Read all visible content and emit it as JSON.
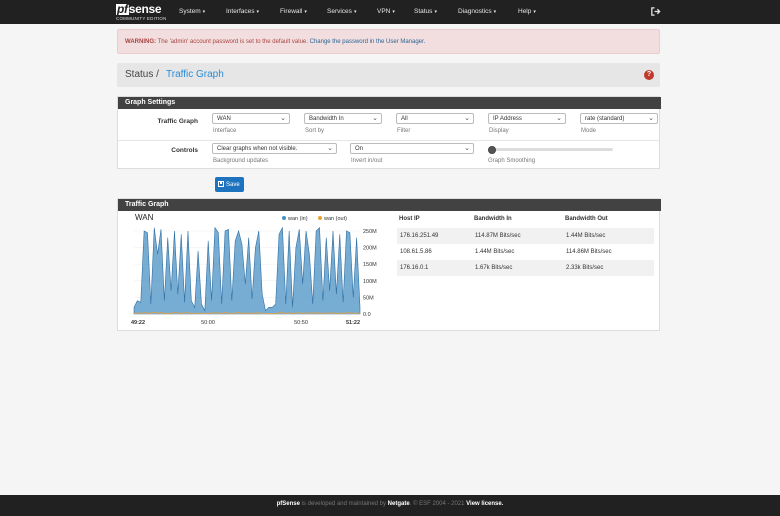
{
  "brand": {
    "logo_pf": "pf",
    "logo_rest": "sense",
    "edition": "COMMUNITY EDITION"
  },
  "nav": [
    "System",
    "Interfaces",
    "Firewall",
    "Services",
    "VPN",
    "Status",
    "Diagnostics",
    "Help"
  ],
  "nav_caret": "▾",
  "icons": {
    "logout": "logout-icon",
    "help": "help-icon",
    "save": "floppy-disk-icon"
  },
  "alert": {
    "label": "WARNING:",
    "message": " The 'admin' account password is set to the default value. ",
    "link": "Change the password in the User Manager."
  },
  "breadcrumb": {
    "root": "Status /",
    "current": "Traffic Graph",
    "help_glyph": "?"
  },
  "settings": {
    "heading": "Graph Settings",
    "row1_label": "Traffic Graph",
    "row2_label": "Controls",
    "interface": {
      "value": "WAN",
      "help": "Interface"
    },
    "sort_by": {
      "value": "Bandwidth In",
      "help": "Sort by"
    },
    "filter": {
      "value": "All",
      "help": "Filter"
    },
    "display": {
      "value": "IP Address",
      "help": "Display"
    },
    "mode": {
      "value": "rate (standard)",
      "help": "Mode"
    },
    "background_updates": {
      "value": "Clear graphs when not visible.",
      "help": "Background updates"
    },
    "invert": {
      "value": "On",
      "help": "Invert in/out"
    },
    "smoothing": {
      "help": "Graph Smoothing",
      "level": 0
    }
  },
  "save_label": "Save",
  "graph": {
    "heading": "Traffic Graph",
    "title": "WAN",
    "legend_in": "wan (in)",
    "legend_out": "wan (out)",
    "color_in": "#4a90c4",
    "color_out": "#f0a030"
  },
  "chart_data": {
    "type": "area",
    "title": "WAN",
    "x_ticks": [
      "49:22",
      "50:00",
      "50:50",
      "51:22"
    ],
    "y_ticks": [
      "250M",
      "200M",
      "150M",
      "100M",
      "50M",
      "0.0"
    ],
    "ylim": [
      0,
      280
    ],
    "y_unit": "M bits/sec",
    "legend_position": "top-right",
    "series": [
      {
        "name": "wan (in)",
        "color": "#4a90c4",
        "values": [
          20,
          40,
          35,
          250,
          245,
          30,
          260,
          180,
          255,
          40,
          230,
          70,
          250,
          60,
          240,
          35,
          250,
          40,
          20,
          190,
          30,
          10,
          220,
          40,
          260,
          245,
          30,
          250,
          255,
          40,
          220,
          250,
          210,
          90,
          230,
          45,
          200,
          250,
          60,
          10,
          20,
          20,
          30,
          240,
          260,
          30,
          250,
          20,
          200,
          255,
          90,
          250,
          180,
          30,
          250,
          260,
          40,
          230,
          70,
          250,
          60,
          240,
          35,
          250,
          245,
          50,
          230,
          20
        ]
      },
      {
        "name": "wan (out)",
        "color": "#f0a030",
        "values": [
          2,
          3,
          2,
          4,
          3,
          2,
          5,
          3,
          4,
          2,
          3,
          2,
          4,
          3,
          2,
          3,
          4,
          2,
          2,
          3,
          2,
          1,
          3,
          2,
          4,
          3,
          2,
          4,
          3,
          2,
          3,
          4,
          3,
          2,
          3,
          2,
          3,
          4,
          2,
          1,
          2,
          2,
          2,
          3,
          4,
          2,
          3,
          2,
          3,
          4,
          2,
          3,
          3,
          2,
          4,
          3,
          2,
          3,
          2,
          4,
          2,
          3,
          2,
          4,
          3,
          2,
          3,
          2
        ]
      }
    ]
  },
  "table": {
    "headers": [
      "Host IP",
      "Bandwidth In",
      "Bandwidth Out"
    ],
    "rows": [
      [
        "176.16.251.49",
        "114.87M Bits/sec",
        "1.44M Bits/sec"
      ],
      [
        "108.61.5.86",
        "1.44M Bits/sec",
        "114.86M Bits/sec"
      ],
      [
        "176.16.0.1",
        "1.67k Bits/sec",
        "2.33k Bits/sec"
      ]
    ]
  },
  "footer": {
    "brand": "pfSense",
    "text1": " is developed and maintained by ",
    "company": "Netgate",
    "text2": ". © ESF 2004 - 2021 ",
    "license": "View license."
  }
}
